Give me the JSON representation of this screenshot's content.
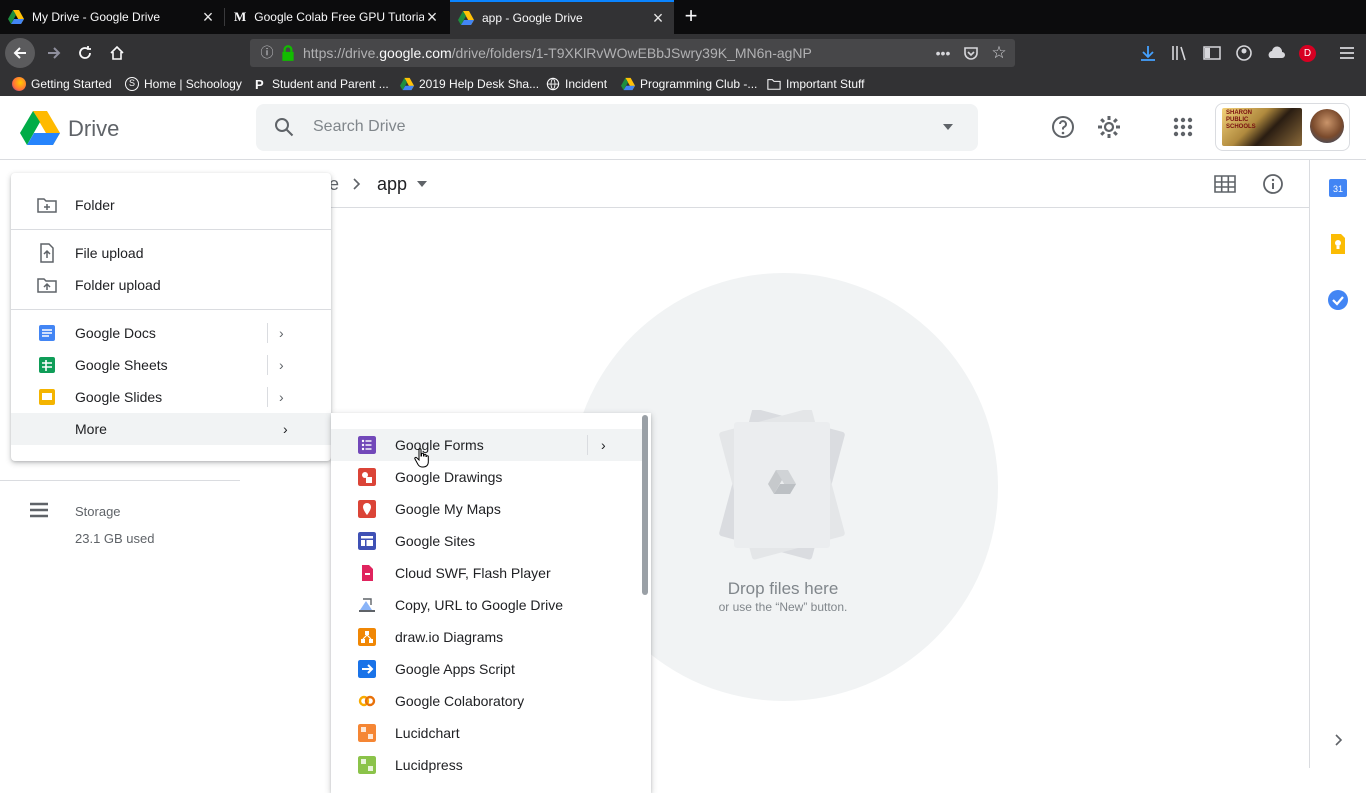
{
  "browser": {
    "tabs": [
      {
        "title": "My Drive - Google Drive",
        "active": false
      },
      {
        "title": "Google Colab Free GPU Tutorial",
        "active": false
      },
      {
        "title": "app - Google Drive",
        "active": true
      }
    ],
    "url": {
      "prefix": "https://drive.",
      "domain": "google.com",
      "path": "/drive/folders/1-T9XKlRvWOwEBbJSwry39K_MN6n-agNP"
    },
    "bookmarks": [
      {
        "label": "Getting Started",
        "icon": "firefox-icon"
      },
      {
        "label": "Home | Schoology",
        "icon": "schoology-icon"
      },
      {
        "label": "Student and Parent ...",
        "icon": "p-icon"
      },
      {
        "label": "2019 Help Desk Sha...",
        "icon": "drive-icon"
      },
      {
        "label": "Incident",
        "icon": "globe-icon"
      },
      {
        "label": "Programming Club -...",
        "icon": "drive-icon"
      },
      {
        "label": "Important Stuff",
        "icon": "folder-icon"
      }
    ],
    "profile_badge": "D"
  },
  "drive": {
    "logo_text": "Drive",
    "search_placeholder": "Search Drive",
    "breadcrumb": {
      "parent_fragment": "e",
      "current": "app"
    },
    "storage": {
      "label": "Storage",
      "used": "23.1 GB used"
    },
    "empty_state": {
      "title": "Drop files here",
      "subtitle": "or use the “New” button."
    },
    "account_text": "SHARON PUBLIC SCHOOLS",
    "calendar_day": "31"
  },
  "new_menu": {
    "folder": "Folder",
    "file_upload": "File upload",
    "folder_upload": "Folder upload",
    "google_docs": "Google Docs",
    "google_sheets": "Google Sheets",
    "google_slides": "Google Slides",
    "more": "More"
  },
  "more_menu": {
    "items": [
      {
        "label": "Google Forms",
        "color": "#7248b9"
      },
      {
        "label": "Google Drawings",
        "color": "#db4437"
      },
      {
        "label": "Google My Maps",
        "color": "#db4437"
      },
      {
        "label": "Google Sites",
        "color": "#3f51b5"
      },
      {
        "label": "Cloud SWF, Flash Player",
        "color": "#e0245e"
      },
      {
        "label": "Copy, URL to Google Drive",
        "color": "#5f6368"
      },
      {
        "label": "draw.io Diagrams",
        "color": "#f08705"
      },
      {
        "label": "Google Apps Script",
        "color": "#1a73e8"
      },
      {
        "label": "Google Colaboratory",
        "color": "#f9ab00"
      },
      {
        "label": "Lucidchart",
        "color": "#f58634"
      },
      {
        "label": "Lucidpress",
        "color": "#8bc34a"
      }
    ]
  }
}
